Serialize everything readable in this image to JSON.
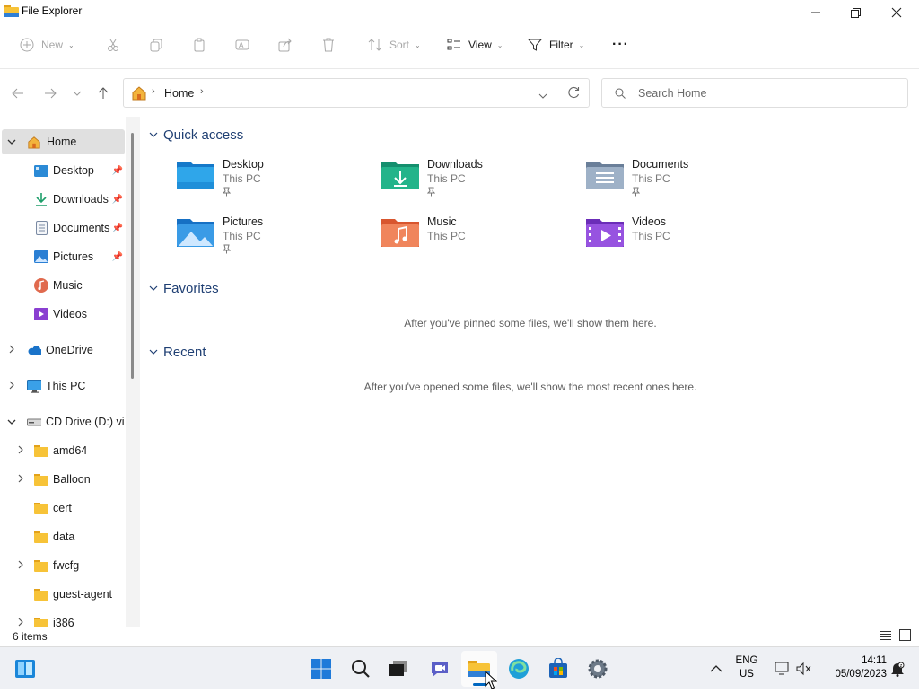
{
  "window": {
    "title": "File Explorer"
  },
  "commandbar": {
    "new_label": "New",
    "sort_label": "Sort",
    "view_label": "View",
    "filter_label": "Filter",
    "more_label": "···"
  },
  "address": {
    "home_crumb": "Home",
    "search_placeholder": "Search Home"
  },
  "nav": {
    "home": "Home",
    "desktop": "Desktop",
    "downloads": "Downloads",
    "documents": "Documents",
    "pictures": "Pictures",
    "music": "Music",
    "videos": "Videos",
    "onedrive": "OneDrive",
    "thispc": "This PC",
    "cddrive": "CD Drive (D:) virtio-win",
    "folders": [
      "amd64",
      "Balloon",
      "cert",
      "data",
      "fwcfg",
      "guest-agent",
      "i386"
    ]
  },
  "content": {
    "quick_access_title": "Quick access",
    "favorites_title": "Favorites",
    "recent_title": "Recent",
    "favorites_empty": "After you've pinned some files, we'll show them here.",
    "recent_empty": "After you've opened some files, we'll show the most recent ones here.",
    "quick_access": [
      {
        "name": "Desktop",
        "location": "This PC",
        "icon": "desktop-folder-icon",
        "pinned": true
      },
      {
        "name": "Downloads",
        "location": "This PC",
        "icon": "downloads-folder-icon",
        "pinned": true
      },
      {
        "name": "Documents",
        "location": "This PC",
        "icon": "documents-folder-icon",
        "pinned": true
      },
      {
        "name": "Pictures",
        "location": "This PC",
        "icon": "pictures-folder-icon",
        "pinned": true
      },
      {
        "name": "Music",
        "location": "This PC",
        "icon": "music-folder-icon",
        "pinned": false
      },
      {
        "name": "Videos",
        "location": "This PC",
        "icon": "videos-folder-icon",
        "pinned": false
      }
    ]
  },
  "status": {
    "items": "6 items"
  },
  "taskbar": {
    "lang_top": "ENG",
    "lang_bottom": "US",
    "time": "14:11",
    "date": "05/09/2023"
  },
  "colors": {
    "accent": "#0067c0",
    "section_title": "#1f3f73",
    "nav_selected": "#e0e0e0"
  }
}
